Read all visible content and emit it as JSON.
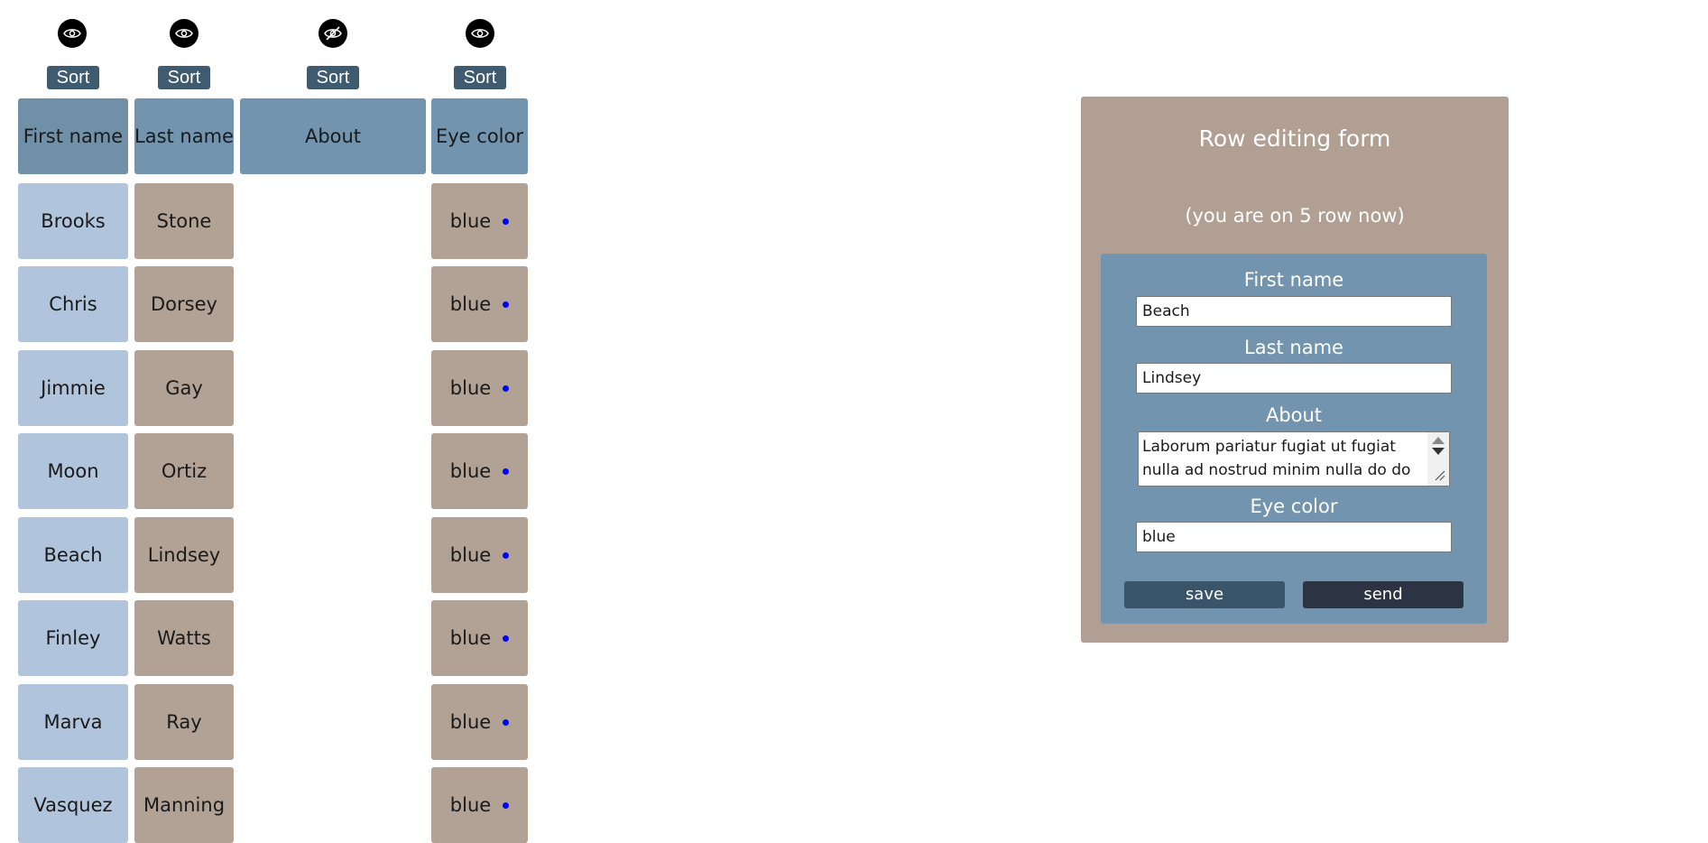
{
  "table": {
    "headers": [
      {
        "label": "First name",
        "sort_label": "Sort",
        "visibility_icon": "eye-icon"
      },
      {
        "label": "Last name",
        "sort_label": "Sort",
        "visibility_icon": "eye-icon"
      },
      {
        "label": "About",
        "sort_label": "Sort",
        "visibility_icon": "eye-slash-icon"
      },
      {
        "label": "Eye color",
        "sort_label": "Sort",
        "visibility_icon": "eye-icon"
      }
    ],
    "rows": [
      {
        "first_name": "Brooks",
        "last_name": "Stone",
        "eye_color": "blue"
      },
      {
        "first_name": "Chris",
        "last_name": "Dorsey",
        "eye_color": "blue"
      },
      {
        "first_name": "Jimmie",
        "last_name": "Gay",
        "eye_color": "blue"
      },
      {
        "first_name": "Moon",
        "last_name": "Ortiz",
        "eye_color": "blue"
      },
      {
        "first_name": "Beach",
        "last_name": "Lindsey",
        "eye_color": "blue"
      },
      {
        "first_name": "Finley",
        "last_name": "Watts",
        "eye_color": "blue"
      },
      {
        "first_name": "Marva",
        "last_name": "Ray",
        "eye_color": "blue"
      },
      {
        "first_name": "Vasquez",
        "last_name": "Manning",
        "eye_color": "blue"
      }
    ]
  },
  "form": {
    "title": "Row editing form",
    "subtitle": "(you are on 5 row now)",
    "first_name_label": "First name",
    "first_name_value": "Beach",
    "last_name_label": "Last name",
    "last_name_value": "Lindsey",
    "about_label": "About",
    "about_value": "Laborum pariatur fugiat ut fugiat nulla ad nostrud minim nulla do do",
    "eye_color_label": "Eye color",
    "eye_color_value": "blue",
    "save_label": "save",
    "send_label": "send"
  },
  "colors": {
    "header_bg": "#7294ae",
    "first_name_cell_bg": "#b0c4dc",
    "last_name_cell_bg": "#b2a295",
    "sort_button_bg": "#3f5b70",
    "form_panel_bg": "#b09f92",
    "form_inner_bg": "#7294ae",
    "eye_color_dot": "#0000ff"
  }
}
